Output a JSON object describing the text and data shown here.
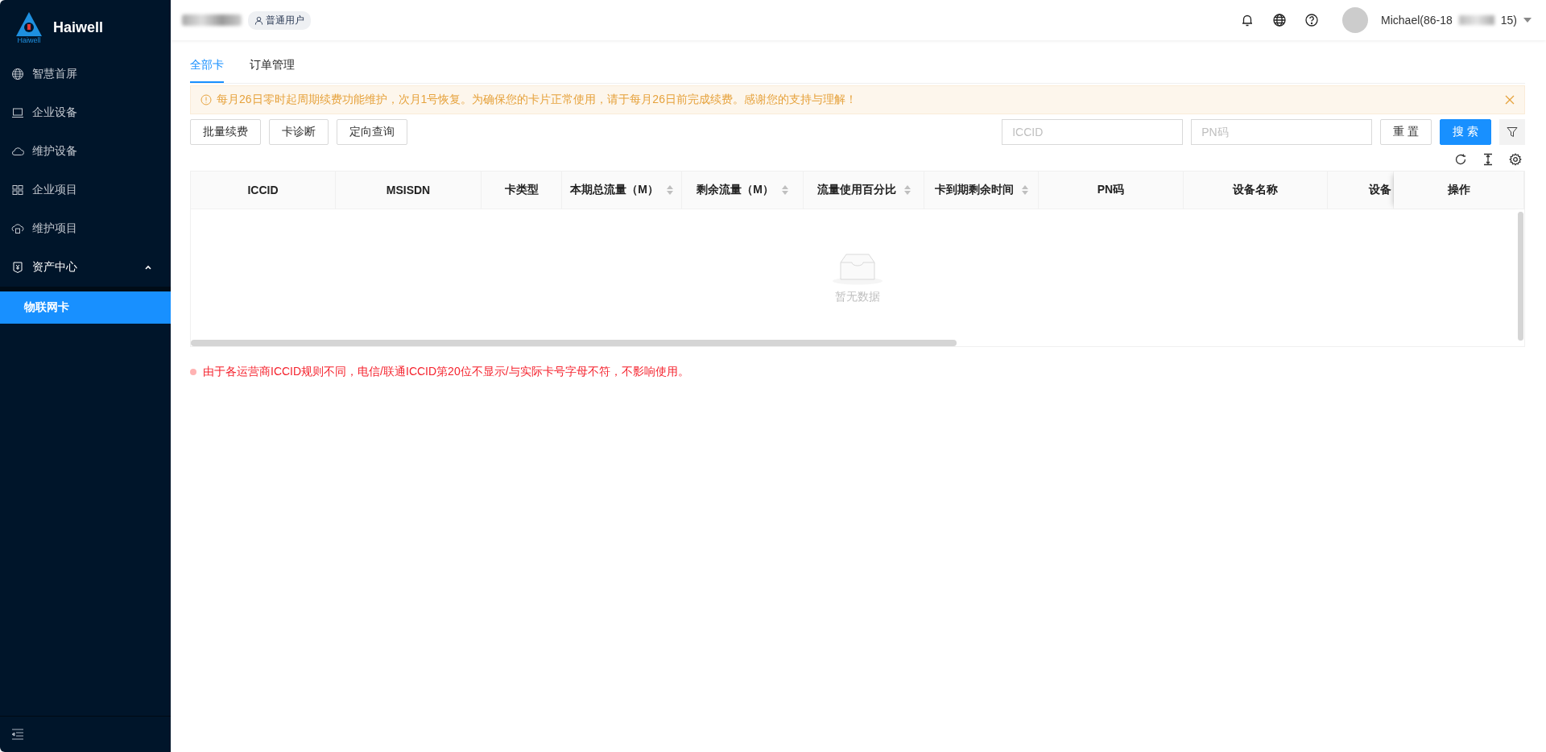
{
  "sidebar": {
    "brand": "Haiwell",
    "logo_caption": "Haiwell",
    "items": [
      {
        "label": "智慧首屏",
        "kind": "globe",
        "selected": false
      },
      {
        "label": "企业设备",
        "kind": "laptop",
        "selected": false
      },
      {
        "label": "维护设备",
        "kind": "cloud",
        "selected": false
      },
      {
        "label": "企业项目",
        "kind": "grid",
        "selected": false
      },
      {
        "label": "维护项目",
        "kind": "cloudbox",
        "selected": false
      },
      {
        "label": "资产中心",
        "kind": "shield",
        "selected": false,
        "expanded": true,
        "children": [
          {
            "label": "物联网卡",
            "selected": true
          }
        ]
      }
    ]
  },
  "header": {
    "role_badge": "普通用户",
    "user_name": "Michael(86-18",
    "user_name_end": "15)"
  },
  "tabs": [
    {
      "label": "全部卡",
      "selected": true
    },
    {
      "label": "订单管理",
      "selected": false
    }
  ],
  "alert": {
    "text": "每月26日零时起周期续费功能维护，次月1号恢复。为确保您的卡片正常使用，请于每月26日前完成续费。感谢您的支持与理解！"
  },
  "actions": [
    "批量续费",
    "卡诊断",
    "定向查询"
  ],
  "search": {
    "iccid_placeholder": "ICCID",
    "pn_placeholder": "PN码",
    "reset": "重 置",
    "submit": "搜 索"
  },
  "table": {
    "columns": [
      {
        "label": "ICCID",
        "sortable": false
      },
      {
        "label": "MSISDN",
        "sortable": false
      },
      {
        "label": "卡类型",
        "sortable": false
      },
      {
        "label": "本期总流量（M）",
        "sortable": true
      },
      {
        "label": "剩余流量（M）",
        "sortable": true
      },
      {
        "label": "流量使用百分比",
        "sortable": true
      },
      {
        "label": "卡到期剩余时间",
        "sortable": true
      },
      {
        "label": "PN码",
        "sortable": false
      },
      {
        "label": "设备名称",
        "sortable": false
      },
      {
        "label": "设备",
        "sortable": false
      },
      {
        "label": "操作",
        "sortable": false
      }
    ],
    "empty_text": "暂无数据"
  },
  "note": "由于各运营商ICCID规则不同，电信/联通ICCID第20位不显示/与实际卡号字母不符，不影响使用。"
}
